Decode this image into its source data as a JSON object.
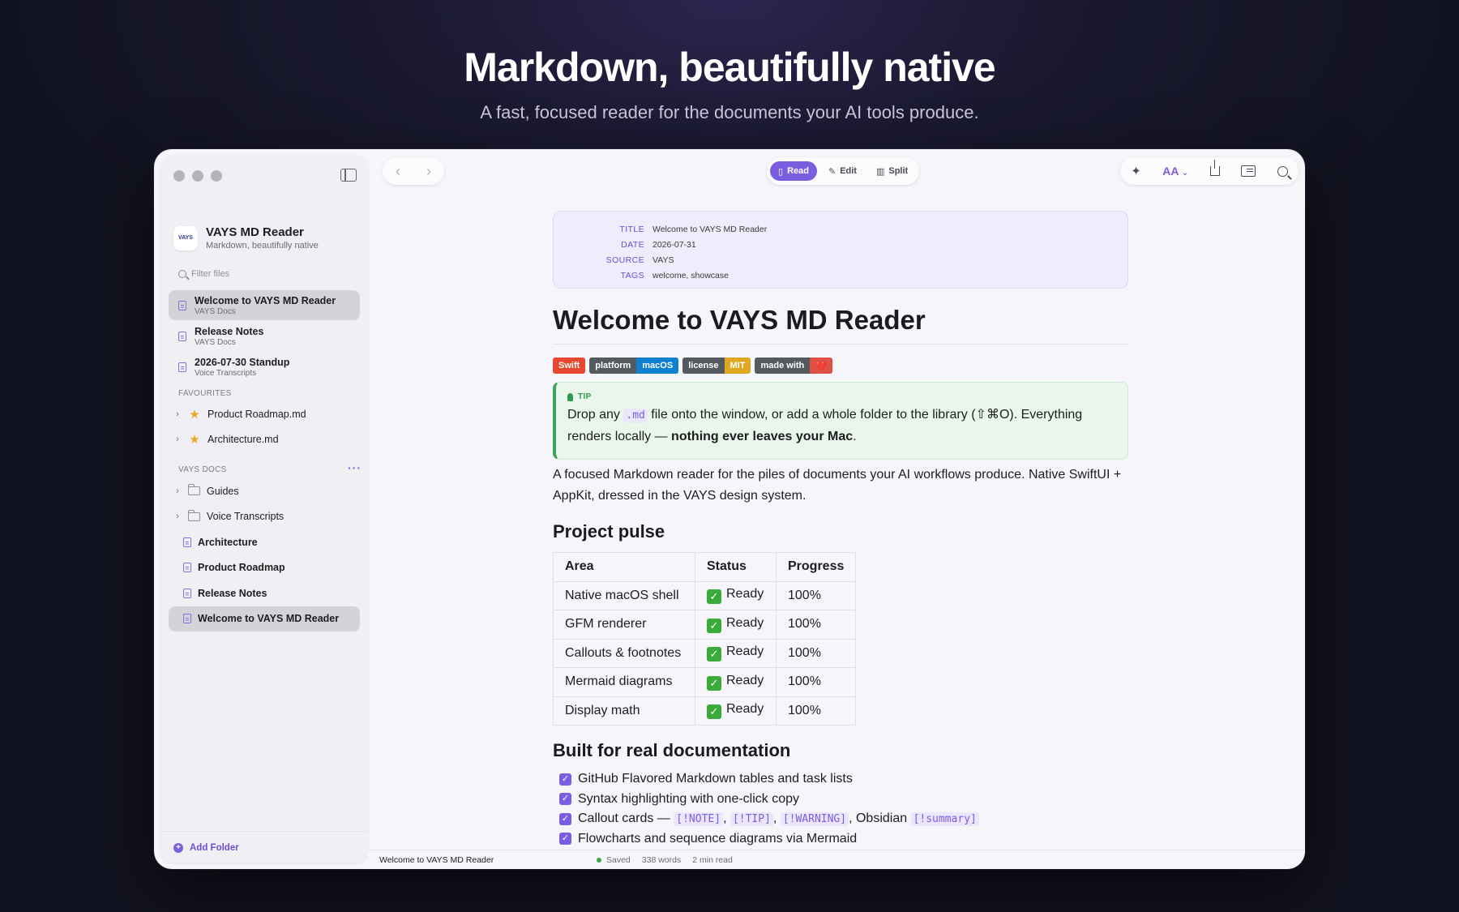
{
  "hero": {
    "title": "Markdown, beautifully native",
    "subtitle": "A fast, focused reader for the documents your AI tools produce."
  },
  "sidebar": {
    "app_name": "VAYS MD Reader",
    "app_tagline": "Markdown, beautifully native",
    "logo_text": "VAYS",
    "filter_placeholder": "Filter files",
    "recent": [
      {
        "title": "Welcome to VAYS MD Reader",
        "sub": "VAYS Docs",
        "selected": true
      },
      {
        "title": "Release Notes",
        "sub": "VAYS Docs",
        "selected": false
      },
      {
        "title": "2026-07-30 Standup",
        "sub": "Voice Transcripts",
        "selected": false
      }
    ],
    "favourites_heading": "FAVOURITES",
    "favourites": [
      "Product Roadmap.md",
      "Architecture.md"
    ],
    "docs_heading": "VAYS DOCS",
    "docs_more": "···",
    "folders": [
      "Guides",
      "Voice Transcripts"
    ],
    "files": [
      "Architecture",
      "Product Roadmap",
      "Release Notes",
      "Welcome to VAYS MD Reader"
    ],
    "add_folder": "Add Folder"
  },
  "toolbar": {
    "back": "‹",
    "forward": "›",
    "modes": [
      "Read",
      "Edit",
      "Split"
    ],
    "active_mode": "Read",
    "font_label": "AA"
  },
  "doc": {
    "meta": [
      {
        "k": "TITLE",
        "v": "Welcome to VAYS MD Reader"
      },
      {
        "k": "DATE",
        "v": "2026-07-31"
      },
      {
        "k": "SOURCE",
        "v": "VAYS"
      },
      {
        "k": "TAGS",
        "v": "welcome, showcase"
      }
    ],
    "h1": "Welcome to VAYS MD Reader",
    "badges": {
      "swift": "Swift",
      "platform_k": "platform",
      "platform_v": "macOS",
      "license_k": "license",
      "license_v": "MIT",
      "made_k": "made with",
      "made_v": "❤️"
    },
    "tip": {
      "label": "TIP",
      "t1": "Drop any ",
      "code": ".md",
      "t2": " file onto the window, or add a whole folder to the library (⇧⌘O). Everything renders locally — ",
      "bold": "nothing ever leaves your Mac",
      "t3": "."
    },
    "intro": "A focused Markdown reader for the piles of documents your AI workflows produce. Native SwiftUI + AppKit, dressed in the VAYS design system.",
    "h2_pulse": "Project pulse",
    "table": {
      "headers": [
        "Area",
        "Status",
        "Progress"
      ],
      "rows": [
        [
          "Native macOS shell",
          "Ready",
          "100%"
        ],
        [
          "GFM renderer",
          "Ready",
          "100%"
        ],
        [
          "Callouts & footnotes",
          "Ready",
          "100%"
        ],
        [
          "Mermaid diagrams",
          "Ready",
          "100%"
        ],
        [
          "Display math",
          "Ready",
          "100%"
        ]
      ]
    },
    "h2_built": "Built for real documentation",
    "tasks": {
      "t1": "GitHub Flavored Markdown tables and task lists",
      "t2": "Syntax highlighting with one-click copy",
      "t3_pre": "Callout cards — ",
      "c1": "[!NOTE]",
      "c2": "[!TIP]",
      "c3": "[!WARNING]",
      "t3_mid": ", Obsidian ",
      "c4": "[!summary]",
      "t4": "Flowcharts and sequence diagrams via Mermaid"
    }
  },
  "status": {
    "file": "Welcome to VAYS MD Reader",
    "saved": "Saved",
    "words": "338 words",
    "read_time": "2 min read"
  },
  "colors": {
    "accent": "#7b5de0",
    "tip_green": "#3aa55a"
  }
}
